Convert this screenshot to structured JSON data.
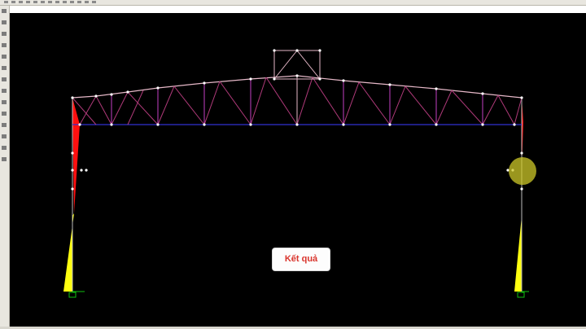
{
  "result_button": {
    "label": "Kết quả"
  },
  "colors": {
    "background": "#000000",
    "truss_top_chord": "#e6b8c8",
    "truss_diagonal": "#b03a7a",
    "truss_vertical": "#c440c4",
    "bottom_chord": "#3030d0",
    "moment_diagram_top": "#ff1010",
    "moment_diagram_bottom": "#ffff10",
    "node": "#ffffff",
    "support": "#10c010",
    "cursor_highlight": "#cec828",
    "result_button_text": "#d9332b"
  },
  "icons": {
    "toolbar": [
      "new-icon",
      "open-icon",
      "save-icon",
      "print-icon",
      "undo-icon",
      "redo-icon",
      "zoom-icon",
      "pan-icon",
      "select-icon",
      "draw-frame-icon",
      "draw-shell-icon",
      "run-icon",
      "display-icon"
    ],
    "left_toolbar": [
      "pointer-icon",
      "line-icon",
      "area-icon",
      "node-icon",
      "restraint-icon",
      "section-icon",
      "load-icon",
      "view-3d-icon",
      "view-xy-icon",
      "view-xz-icon",
      "view-yz-icon",
      "rotate-icon",
      "zoom-in-icon",
      "zoom-out-icon"
    ]
  }
}
